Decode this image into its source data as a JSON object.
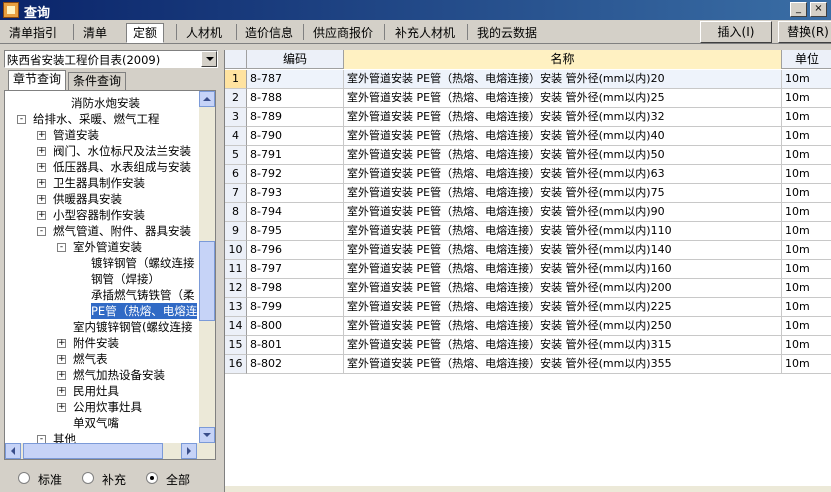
{
  "window": {
    "title": "查询",
    "minimize_label": "_",
    "close_label": "×"
  },
  "tabs": [
    {
      "label": "清单指引",
      "active": false
    },
    {
      "label": "清单",
      "active": false
    },
    {
      "label": "定额",
      "active": true
    },
    {
      "label": "人材机",
      "active": false
    },
    {
      "label": "造价信息",
      "active": false
    },
    {
      "label": "供应商报价",
      "active": false
    },
    {
      "label": "补充人材机",
      "active": false
    },
    {
      "label": "我的云数据",
      "active": false
    }
  ],
  "toolbar": {
    "insert_label": "插入(I)",
    "replace_label": "替换(R)"
  },
  "library_select": {
    "value": "陕西省安装工程价目表(2009)"
  },
  "subtabs": [
    {
      "label": "章节查询",
      "active": true
    },
    {
      "label": "条件查询",
      "active": false
    }
  ],
  "tree": [
    {
      "label": "消防水炮安装",
      "level": 3,
      "expander": ""
    },
    {
      "label": "给排水、采暖、燃气工程",
      "level": 0,
      "expander": "-"
    },
    {
      "label": "管道安装",
      "level": 1,
      "expander": "+"
    },
    {
      "label": "阀门、水位标尺及法兰安装",
      "level": 1,
      "expander": "+"
    },
    {
      "label": "低压器具、水表组成与安装",
      "level": 1,
      "expander": "+"
    },
    {
      "label": "卫生器具制作安装",
      "level": 1,
      "expander": "+"
    },
    {
      "label": "供暖器具安装",
      "level": 1,
      "expander": "+"
    },
    {
      "label": "小型容器制作安装",
      "level": 1,
      "expander": "+"
    },
    {
      "label": "燃气管道、附件、器具安装",
      "level": 1,
      "expander": "-"
    },
    {
      "label": "室外管道安装",
      "level": 2,
      "expander": "-"
    },
    {
      "label": "镀锌钢管（螺纹连接",
      "level": 3,
      "expander": ""
    },
    {
      "label": "钢管（焊接）",
      "level": 3,
      "expander": ""
    },
    {
      "label": "承插燃气铸铁管（柔",
      "level": 3,
      "expander": ""
    },
    {
      "label": "PE管（热熔、电熔连",
      "level": 3,
      "expander": "",
      "selected": true
    },
    {
      "label": "室内镀锌钢管(螺纹连接",
      "level": 2,
      "expander": ""
    },
    {
      "label": "附件安装",
      "level": 2,
      "expander": "+"
    },
    {
      "label": "燃气表",
      "level": 2,
      "expander": "+"
    },
    {
      "label": "燃气加热设备安装",
      "level": 2,
      "expander": "+"
    },
    {
      "label": "民用灶具",
      "level": 2,
      "expander": "+"
    },
    {
      "label": "公用炊事灶具",
      "level": 2,
      "expander": "+"
    },
    {
      "label": "单双气嘴",
      "level": 2,
      "expander": ""
    },
    {
      "label": "其他",
      "level": 1,
      "expander": "-"
    }
  ],
  "filter": {
    "options": [
      {
        "label": "标准",
        "checked": false
      },
      {
        "label": "补充",
        "checked": false
      },
      {
        "label": "全部",
        "checked": true
      }
    ]
  },
  "grid": {
    "columns": {
      "code": "编码",
      "name": "名称",
      "unit": "单位"
    },
    "rows": [
      {
        "idx": "1",
        "code": "8-787",
        "name": "室外管道安装 PE管（热熔、电熔连接）安装 管外径(mm以内)20",
        "unit": "10m"
      },
      {
        "idx": "2",
        "code": "8-788",
        "name": "室外管道安装 PE管（热熔、电熔连接）安装 管外径(mm以内)25",
        "unit": "10m"
      },
      {
        "idx": "3",
        "code": "8-789",
        "name": "室外管道安装 PE管（热熔、电熔连接）安装 管外径(mm以内)32",
        "unit": "10m"
      },
      {
        "idx": "4",
        "code": "8-790",
        "name": "室外管道安装 PE管（热熔、电熔连接）安装 管外径(mm以内)40",
        "unit": "10m"
      },
      {
        "idx": "5",
        "code": "8-791",
        "name": "室外管道安装 PE管（热熔、电熔连接）安装 管外径(mm以内)50",
        "unit": "10m"
      },
      {
        "idx": "6",
        "code": "8-792",
        "name": "室外管道安装 PE管（热熔、电熔连接）安装 管外径(mm以内)63",
        "unit": "10m"
      },
      {
        "idx": "7",
        "code": "8-793",
        "name": "室外管道安装 PE管（热熔、电熔连接）安装 管外径(mm以内)75",
        "unit": "10m"
      },
      {
        "idx": "8",
        "code": "8-794",
        "name": "室外管道安装 PE管（热熔、电熔连接）安装 管外径(mm以内)90",
        "unit": "10m"
      },
      {
        "idx": "9",
        "code": "8-795",
        "name": "室外管道安装 PE管（热熔、电熔连接）安装 管外径(mm以内)110",
        "unit": "10m"
      },
      {
        "idx": "10",
        "code": "8-796",
        "name": "室外管道安装 PE管（热熔、电熔连接）安装 管外径(mm以内)140",
        "unit": "10m"
      },
      {
        "idx": "11",
        "code": "8-797",
        "name": "室外管道安装 PE管（热熔、电熔连接）安装 管外径(mm以内)160",
        "unit": "10m"
      },
      {
        "idx": "12",
        "code": "8-798",
        "name": "室外管道安装 PE管（热熔、电熔连接）安装 管外径(mm以内)200",
        "unit": "10m"
      },
      {
        "idx": "13",
        "code": "8-799",
        "name": "室外管道安装 PE管（热熔、电熔连接）安装 管外径(mm以内)225",
        "unit": "10m"
      },
      {
        "idx": "14",
        "code": "8-800",
        "name": "室外管道安装 PE管（热熔、电熔连接）安装 管外径(mm以内)250",
        "unit": "10m"
      },
      {
        "idx": "15",
        "code": "8-801",
        "name": "室外管道安装 PE管（热熔、电熔连接）安装 管外径(mm以内)315",
        "unit": "10m"
      },
      {
        "idx": "16",
        "code": "8-802",
        "name": "室外管道安装 PE管（热熔、电熔连接）安装 管外径(mm以内)355",
        "unit": "10m"
      }
    ]
  }
}
